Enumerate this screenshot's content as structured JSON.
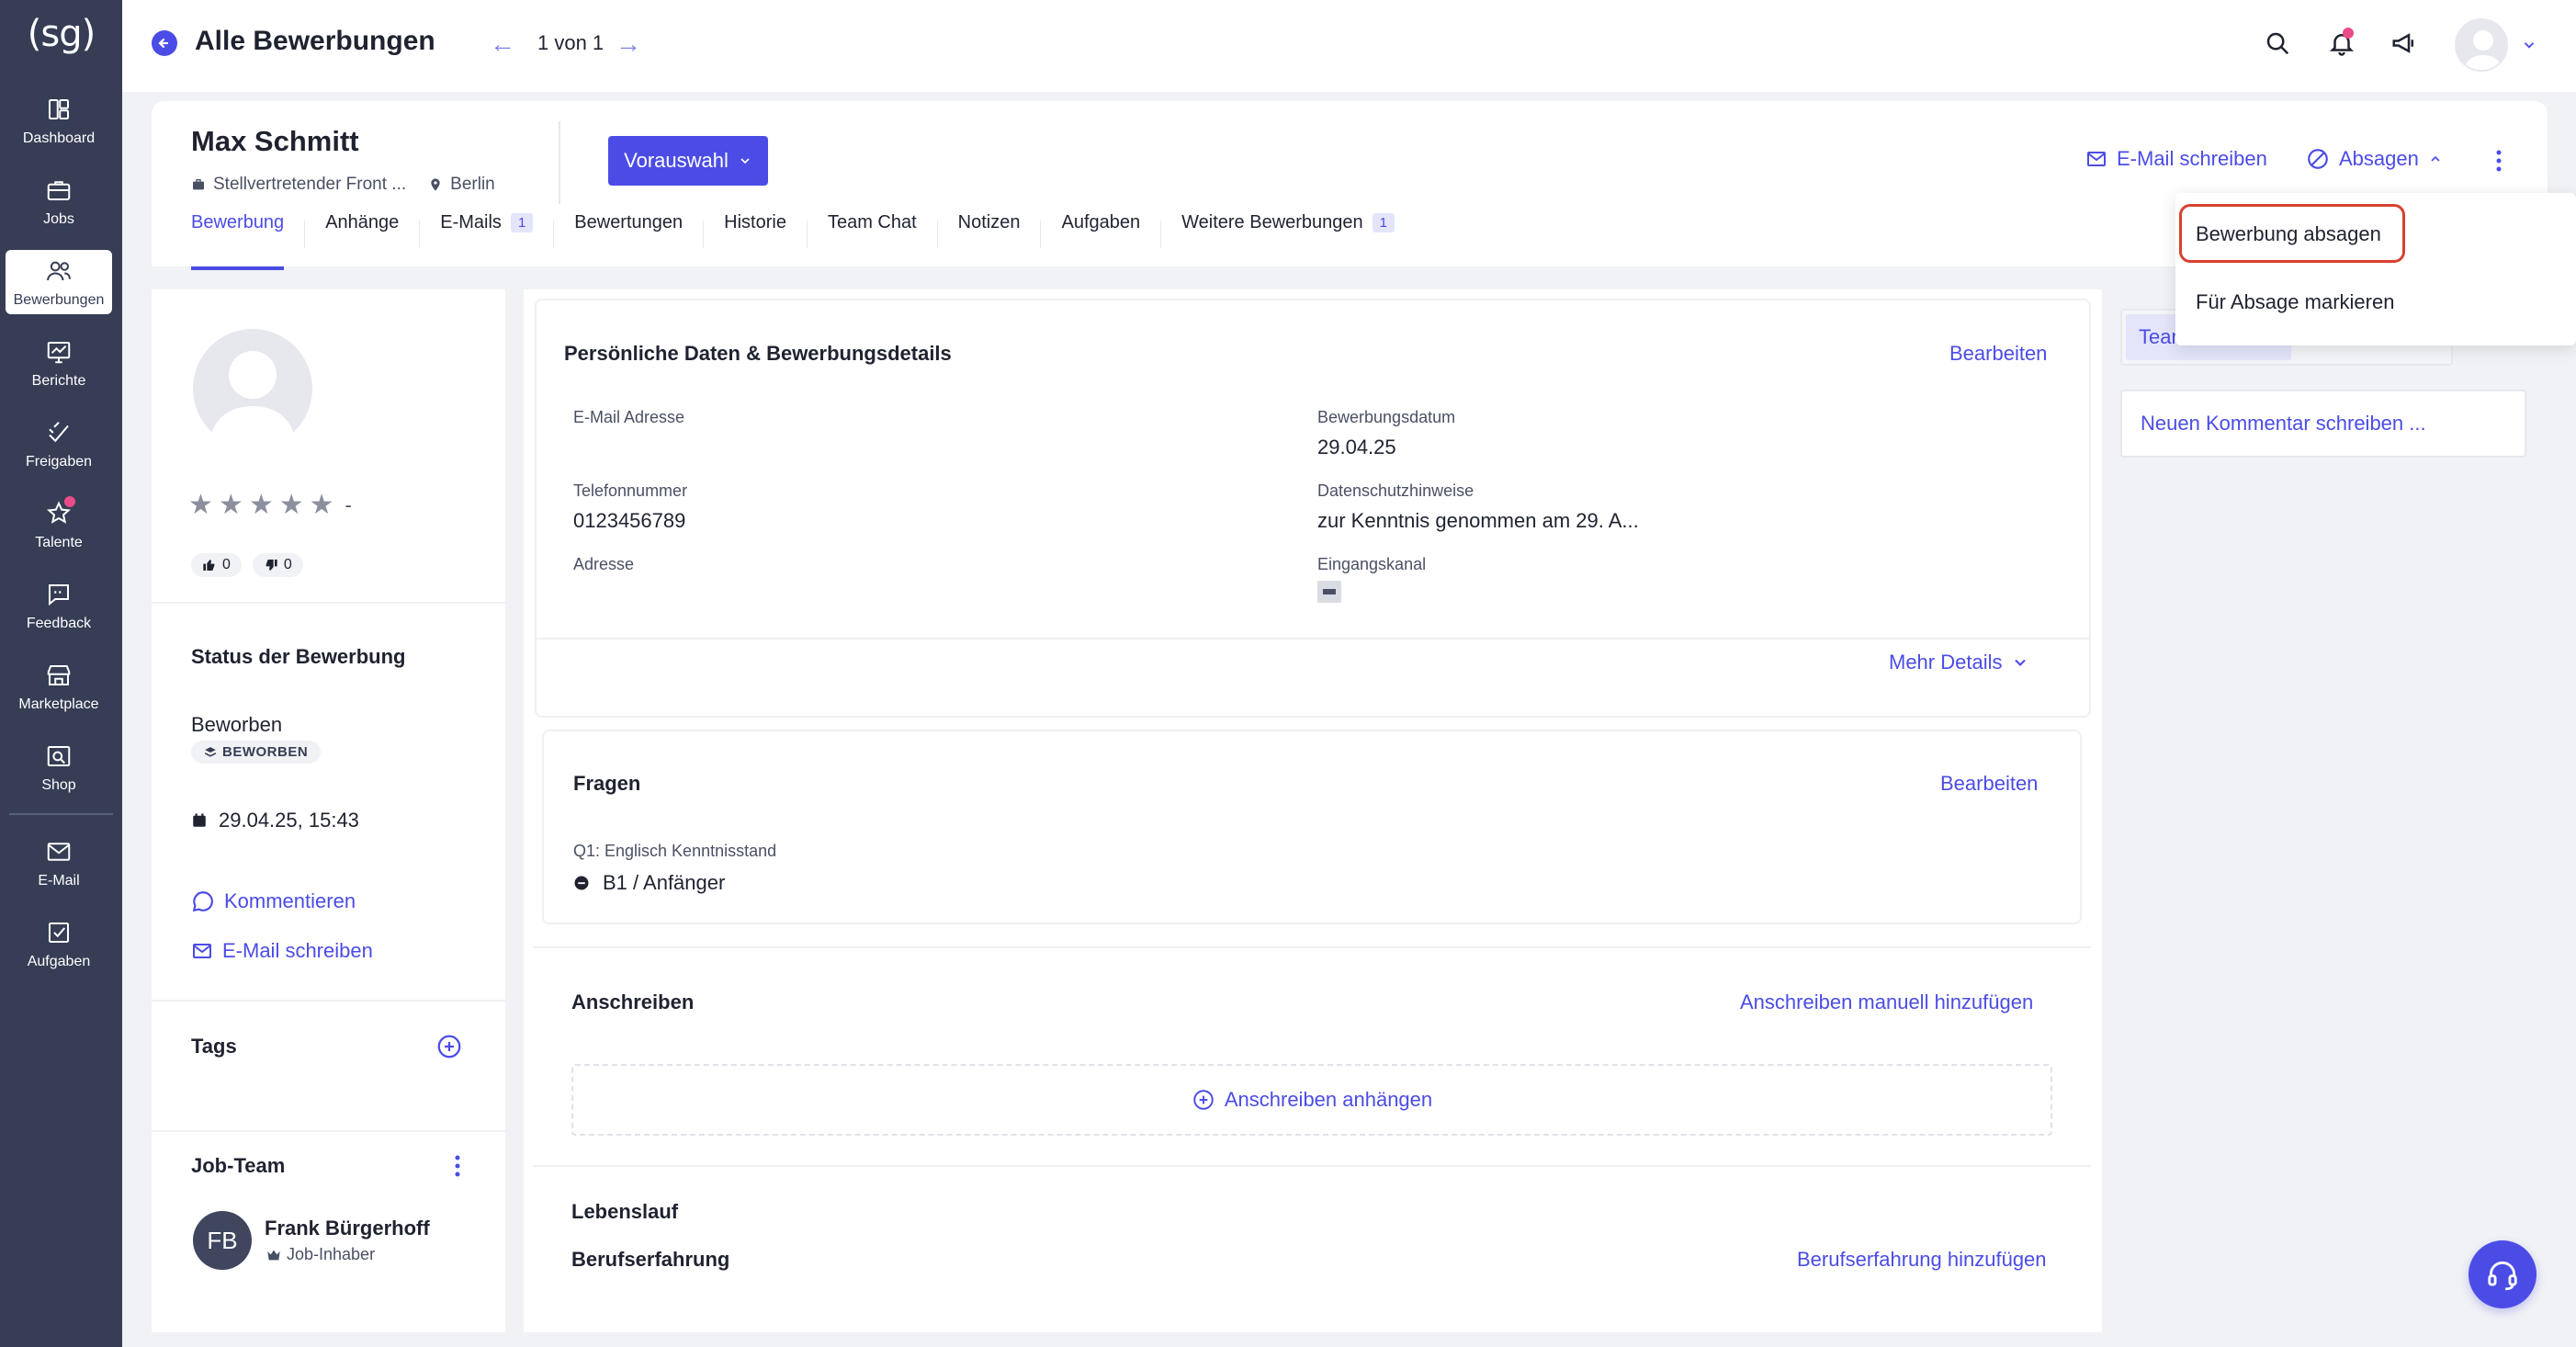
{
  "sidebar": {
    "logo": "(sg)",
    "items": [
      {
        "label": "Dashboard",
        "icon": "dashboard-icon"
      },
      {
        "label": "Jobs",
        "icon": "briefcase-icon"
      },
      {
        "label": "Bewerbungen",
        "icon": "users-icon"
      },
      {
        "label": "Berichte",
        "icon": "chart-icon"
      },
      {
        "label": "Freigaben",
        "icon": "approve-icon"
      },
      {
        "label": "Talente",
        "icon": "star-user-icon"
      },
      {
        "label": "Feedback",
        "icon": "feedback-icon"
      },
      {
        "label": "Marketplace",
        "icon": "store-icon"
      },
      {
        "label": "Shop",
        "icon": "shop-icon"
      },
      {
        "label": "E-Mail",
        "icon": "mail-icon"
      },
      {
        "label": "Aufgaben",
        "icon": "tasks-icon"
      }
    ]
  },
  "topbar": {
    "title": "Alle Bewerbungen",
    "pager": "1 von 1"
  },
  "candidate": {
    "name": "Max Schmitt",
    "position": "Stellvertretender Front ...",
    "location": "Berlin",
    "stage_button": "Vorauswahl",
    "email_action": "E-Mail schreiben",
    "reject_action": "Absagen"
  },
  "tabs": [
    {
      "label": "Bewerbung",
      "count": null
    },
    {
      "label": "Anhänge",
      "count": null
    },
    {
      "label": "E-Mails",
      "count": "1"
    },
    {
      "label": "Bewertungen",
      "count": null
    },
    {
      "label": "Historie",
      "count": null
    },
    {
      "label": "Team Chat",
      "count": null
    },
    {
      "label": "Notizen",
      "count": null
    },
    {
      "label": "Aufgaben",
      "count": null
    },
    {
      "label": "Weitere Bewerbungen",
      "count": "1"
    }
  ],
  "left": {
    "rating_dash": "-",
    "thumbs_up": "0",
    "thumbs_down": "0",
    "status_title": "Status der Bewerbung",
    "status_value": "Beworben",
    "status_badge": "BEWORBEN",
    "date": "29.04.25, 15:43",
    "comment_link": "Kommentieren",
    "email_link": "E-Mail schreiben",
    "tags_title": "Tags",
    "jobteam_title": "Job-Team",
    "member_initials": "FB",
    "member_name": "Frank Bürgerhoff",
    "member_role": "Job-Inhaber"
  },
  "details": {
    "title": "Persönliche Daten & Bewerbungsdetails",
    "edit": "Bearbeiten",
    "email_label": "E-Mail Adresse",
    "date_label": "Bewerbungsdatum",
    "date_value": "29.04.25",
    "phone_label": "Telefonnummer",
    "phone_value": "0123456789",
    "privacy_label": "Datenschutzhinweise",
    "privacy_value": "zur Kenntnis genommen am 29. A...",
    "address_label": "Adresse",
    "channel_label": "Eingangskanal",
    "more": "Mehr Details"
  },
  "questions": {
    "title": "Fragen",
    "edit": "Bearbeiten",
    "q1_label": "Q1: Englisch Kenntnisstand",
    "q1_value": "B1 / Anfänger"
  },
  "cover": {
    "title": "Anschreiben",
    "add_manual": "Anschreiben manuell hinzufügen",
    "attach": "Anschreiben anhängen"
  },
  "cv": {
    "title": "Lebenslauf",
    "experience": "Berufserfahrung",
    "add_experience": "Berufserfahrung hinzufügen"
  },
  "right": {
    "team_tab": "Team Chat",
    "comment_placeholder": "Neuen Kommentar schreiben ..."
  },
  "dropdown": {
    "item1": "Bewerbung absagen",
    "item2": "Für Absage markieren"
  },
  "colors": {
    "sidebar": "#363d55",
    "accent": "#4b4ce6",
    "highlight": "#d8412f"
  }
}
